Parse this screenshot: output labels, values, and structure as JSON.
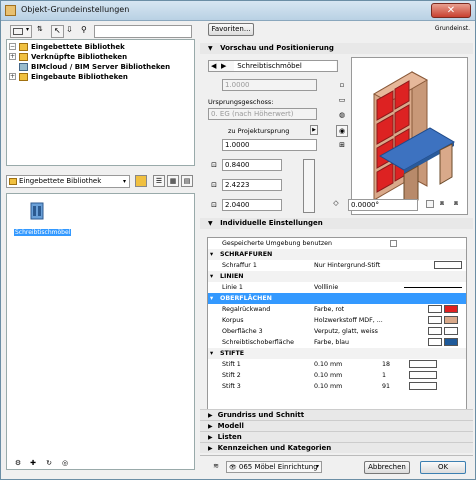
{
  "window": {
    "title": "Objekt-Grundeinstellungen"
  },
  "tree": {
    "items": [
      {
        "label": "Eingebettete Bibliothek"
      },
      {
        "label": "Verknüpfte Bibliotheken"
      },
      {
        "label": "BIMcloud / BIM Server Bibliotheken"
      },
      {
        "label": "Eingebaute Bibliotheken"
      }
    ]
  },
  "library_select": {
    "value": "Eingebettete Bibliothek"
  },
  "file_item": {
    "label": "Schreibtischmöbel"
  },
  "toolbar": {
    "favorites_label": "Favoriten...",
    "default_label": "Grundeinst."
  },
  "preview": {
    "section_title": "Vorschau und Positionierung",
    "object_name": "Schreibtischmöbel",
    "height_value": "1.0000",
    "origin_label": "Ursprungsgeschoss:",
    "origin_value": "0. EG (nach Höherwert)",
    "relative_label": "zu Projektursprung",
    "elevation_value": "1.0000",
    "x_value": "0.8400",
    "y_value": "2.4223",
    "z_value": "2.0400",
    "angle_value": "0.0000°"
  },
  "individual": {
    "section_title": "Individuelle Einstellungen",
    "saved_env_label": "Gespeicherte Umgebung benutzen",
    "rows": [
      {
        "type": "cat",
        "label": "SCHRAFFUREN"
      },
      {
        "type": "item",
        "label": "Schraffur 1",
        "value": "Nur Hintergrund-Stift"
      },
      {
        "type": "cat",
        "label": "LINIEN"
      },
      {
        "type": "item",
        "label": "Linie 1",
        "value": "Volllinie"
      },
      {
        "type": "catsel",
        "label": "OBERFLÄCHEN"
      },
      {
        "type": "item",
        "label": "Regalrückwand",
        "value": "Farbe, rot"
      },
      {
        "type": "item",
        "label": "Korpus",
        "value": "Holzwerkstoff MDF, ..."
      },
      {
        "type": "item",
        "label": "Oberfläche 3",
        "value": "Verputz, glatt, weiss"
      },
      {
        "type": "item",
        "label": "Schreibtischoberfläche",
        "value": "Farbe, blau"
      },
      {
        "type": "cat",
        "label": "STIFTE"
      },
      {
        "type": "item",
        "label": "Stift 1",
        "value": "0.10 mm",
        "pen": "18"
      },
      {
        "type": "item",
        "label": "Stift 2",
        "value": "0.10 mm",
        "pen": "1"
      },
      {
        "type": "item",
        "label": "Stift 3",
        "value": "0.10 mm",
        "pen": "91"
      }
    ]
  },
  "collapsed": [
    {
      "label": "Grundriss und Schnitt"
    },
    {
      "label": "Modell"
    },
    {
      "label": "Listen"
    },
    {
      "label": "Kennzeichen und Kategorien"
    }
  ],
  "footer": {
    "layer_value": "065 Möbel Einrichtung",
    "cancel_label": "Abbrechen",
    "ok_label": "OK"
  },
  "colors": {
    "red": "#e02020",
    "tan": "#d9a98a",
    "white": "#ffffff",
    "blue": "#1f5a9a"
  }
}
